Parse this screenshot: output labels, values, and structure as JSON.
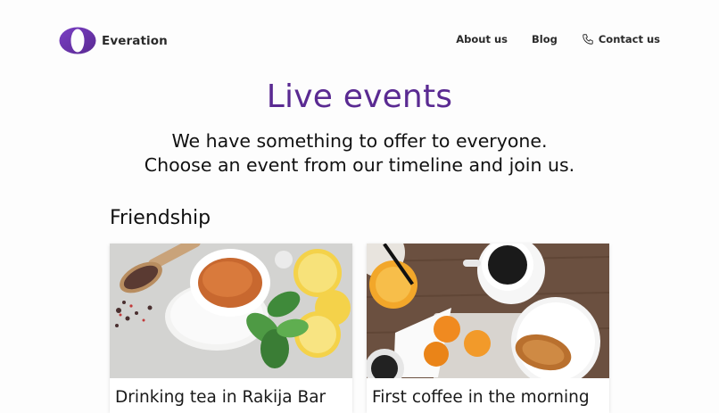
{
  "brand": {
    "name": "Everation",
    "logo_icon": "everation-logo-icon",
    "accent": "#5a2a92"
  },
  "nav": {
    "items": [
      {
        "label": "About us"
      },
      {
        "label": "Blog"
      },
      {
        "label": "Contact us",
        "icon": "phone-icon"
      }
    ]
  },
  "hero": {
    "title": "Live events",
    "subtitle_line1": "We have something to offer to everyone.",
    "subtitle_line2": "Choose an event from our timeline and join us."
  },
  "section": {
    "title": "Friendship"
  },
  "events": [
    {
      "title": "Drinking tea in Rakija Bar",
      "image": "tea-cup-with-lemon-and-mint"
    },
    {
      "title": "First coffee in the morning",
      "image": "breakfast-coffee-orange-juice-croissant"
    }
  ]
}
